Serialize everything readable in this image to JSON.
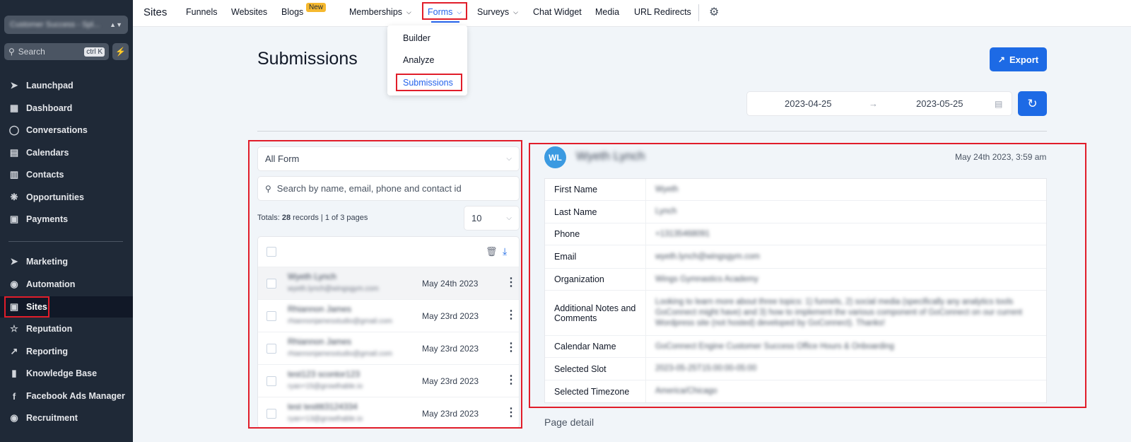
{
  "sidebar": {
    "account": "Customer Success - Spl...",
    "search_label": "Search",
    "search_shortcut": "ctrl K",
    "items": [
      {
        "label": "Launchpad"
      },
      {
        "label": "Dashboard"
      },
      {
        "label": "Conversations"
      },
      {
        "label": "Calendars"
      },
      {
        "label": "Contacts"
      },
      {
        "label": "Opportunities"
      },
      {
        "label": "Payments"
      },
      {
        "label": "Marketing"
      },
      {
        "label": "Automation"
      },
      {
        "label": "Sites"
      },
      {
        "label": "Reputation"
      },
      {
        "label": "Reporting"
      },
      {
        "label": "Knowledge Base"
      },
      {
        "label": "Facebook Ads Manager"
      },
      {
        "label": "Recruitment"
      }
    ]
  },
  "topnav": {
    "title": "Sites",
    "funnels": "Funnels",
    "websites": "Websites",
    "blogs": "Blogs",
    "new_badge": "New",
    "memberships": "Memberships",
    "forms": "Forms",
    "surveys": "Surveys",
    "chat_widget": "Chat Widget",
    "media": "Media",
    "url_redirects": "URL Redirects"
  },
  "forms_menu": {
    "builder": "Builder",
    "analyze": "Analyze",
    "submissions": "Submissions"
  },
  "page": {
    "title": "Submissions",
    "export": "Export",
    "date_from": "2023-04-25",
    "date_to": "2023-05-25"
  },
  "filters": {
    "form_select": "All Form",
    "search_placeholder": "Search by name, email, phone and contact id",
    "totals_prefix": "Totals:",
    "totals_count": "28",
    "totals_suffix": "records | 1 of 3 pages",
    "page_size": "10"
  },
  "submissions": [
    {
      "name": "Wyeth Lynch",
      "email": "wyeth.lynch@wingsgym.com",
      "date": "May 24th 2023"
    },
    {
      "name": "Rhiannon James",
      "email": "rhiannonjamesstudio@gmail.com",
      "date": "May 23rd 2023"
    },
    {
      "name": "Rhiannon James",
      "email": "rhiannonjamesstudio@gmail.com",
      "date": "May 23rd 2023"
    },
    {
      "name": "test123 scontor123",
      "email": "ryan+15@growthable.io",
      "date": "May 23rd 2023"
    },
    {
      "name": "test testttt3124334",
      "email": "ryan+13@growthable.io",
      "date": "May 23rd 2023"
    }
  ],
  "detail": {
    "initials": "WL",
    "name": "Wyeth Lynch",
    "date": "May 24th 2023, 3:59 am",
    "fields": [
      {
        "label": "First Name",
        "value": "Wyeth"
      },
      {
        "label": "Last Name",
        "value": "Lynch"
      },
      {
        "label": "Phone",
        "value": "+13135468091"
      },
      {
        "label": "Email",
        "value": "wyeth.lynch@wingsgym.com"
      },
      {
        "label": "Organization",
        "value": "Wings Gymnastics Academy"
      },
      {
        "label": "Additional Notes and Comments",
        "value": "Looking to learn more about three topics: 1) funnels, 2) social media (specifically any analytics tools GoConnect might have) and 3) how to implement the various component of GoConnect on our current Wordpress site (not hosted) developed by GoConnect). Thanks!"
      },
      {
        "label": "Calendar Name",
        "value": "GoConnect Engine Customer Success Office Hours & Onboarding"
      },
      {
        "label": "Selected Slot",
        "value": "2023-05-25T15:00:00-05:00"
      },
      {
        "label": "Selected Timezone",
        "value": "America/Chicago"
      }
    ],
    "page_detail": "Page detail"
  },
  "colors": {
    "accent": "#1d6ae5",
    "sidebar_bg": "#1f2937",
    "highlight": "#e11d2a"
  }
}
